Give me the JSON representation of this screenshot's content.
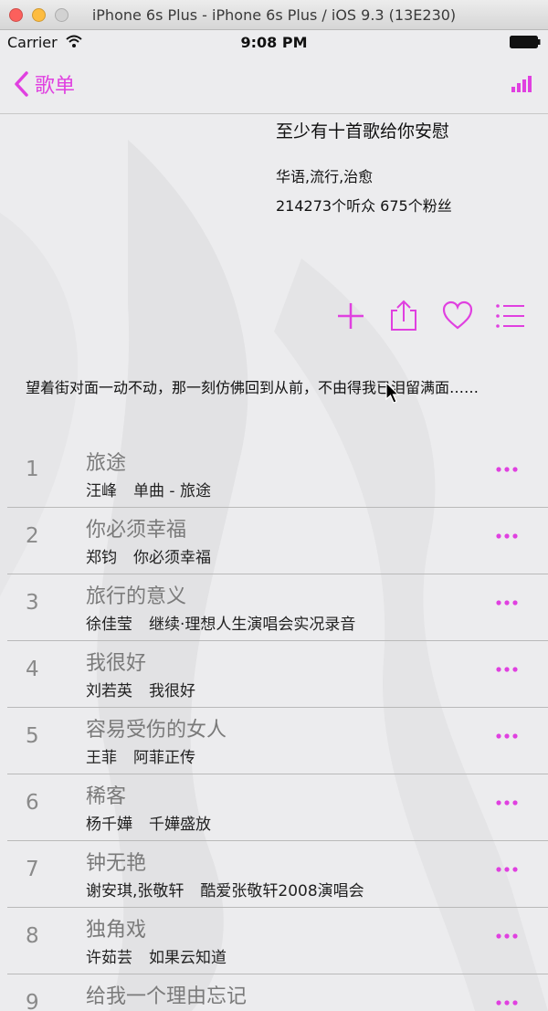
{
  "window": {
    "title": "iPhone 6s Plus - iPhone 6s Plus / iOS 9.3 (13E230)"
  },
  "status_bar": {
    "carrier": "Carrier",
    "time": "9:08 PM"
  },
  "nav": {
    "back_label": "歌单"
  },
  "playlist": {
    "title": "至少有十首歌给你安慰",
    "tags": "华语,流行,治愈",
    "stats": "214273个听众  675个粉丝",
    "description": "望着街对面一动不动，那一刻仿佛回到从前，不由得我已泪留满面……"
  },
  "actions": [
    {
      "name": "add-icon"
    },
    {
      "name": "share-icon"
    },
    {
      "name": "heart-icon"
    },
    {
      "name": "list-icon"
    }
  ],
  "songs": [
    {
      "index": "1",
      "title": "旅途",
      "artist": "汪峰",
      "album": "单曲 - 旅途"
    },
    {
      "index": "2",
      "title": "你必须幸福",
      "artist": "郑钧",
      "album": "你必须幸福"
    },
    {
      "index": "3",
      "title": "旅行的意义",
      "artist": "徐佳莹",
      "album": "继续·理想人生演唱会实况录音"
    },
    {
      "index": "4",
      "title": "我很好",
      "artist": "刘若英",
      "album": "我很好"
    },
    {
      "index": "5",
      "title": "容易受伤的女人",
      "artist": "王菲",
      "album": "阿菲正传"
    },
    {
      "index": "6",
      "title": "稀客",
      "artist": "杨千嬅",
      "album": "千嬅盛放"
    },
    {
      "index": "7",
      "title": "钟无艳",
      "artist": "谢安琪,张敬轩",
      "album": "酷爱张敬轩2008演唱会"
    },
    {
      "index": "8",
      "title": "独角戏",
      "artist": "许茹芸",
      "album": "如果云知道"
    },
    {
      "index": "9",
      "title": "给我一个理由忘记",
      "artist": "",
      "album": ""
    }
  ],
  "colors": {
    "accent": "#e040e0",
    "text": "#111111",
    "muted": "#7a7a7a"
  }
}
